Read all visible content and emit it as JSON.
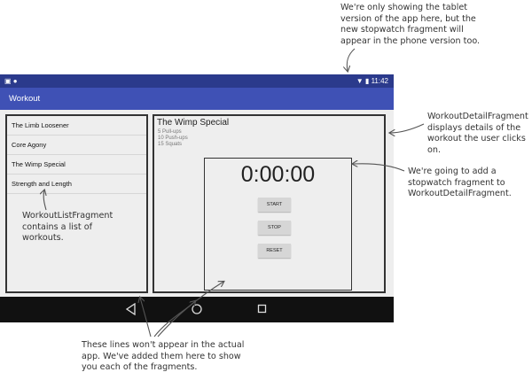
{
  "annotations": {
    "top_right": [
      "We're only showing the tablet",
      "version of the app here, but the",
      "new stopwatch fragment will",
      "appear in the phone version too."
    ],
    "detail_fragment": [
      "WorkoutDetailFragment",
      "displays details of the",
      "workout the user clicks on."
    ],
    "stopwatch_fragment": [
      "We're going to add a",
      "stopwatch fragment to",
      "WorkoutDetailFragment."
    ],
    "list_fragment": [
      "WorkoutListFragment",
      "contains a list of",
      "workouts."
    ],
    "bottom": [
      "These lines won't appear in the actual",
      "app. We've added them here to show",
      "you each of the fragments."
    ]
  },
  "status_bar": {
    "time": "11:42"
  },
  "app_bar": {
    "title": "Workout"
  },
  "workouts": [
    "The Limb Loosener",
    "Core Agony",
    "The Wimp Special",
    "Strength and Length"
  ],
  "detail": {
    "title": "The Wimp Special",
    "lines": [
      "5 Pull-ups",
      "10 Push-ups",
      "15 Squats"
    ]
  },
  "stopwatch": {
    "time": "0:00:00",
    "start": "START",
    "stop": "STOP",
    "reset": "RESET"
  },
  "colors": {
    "app_bar": "#3f51b5",
    "status_bar": "#2b3a8c",
    "nav_bar": "#111111",
    "background": "#eeeeee"
  },
  "icons": {
    "nav_back": "back-triangle-icon",
    "nav_home": "home-circle-icon",
    "nav_recents": "recents-square-icon"
  }
}
